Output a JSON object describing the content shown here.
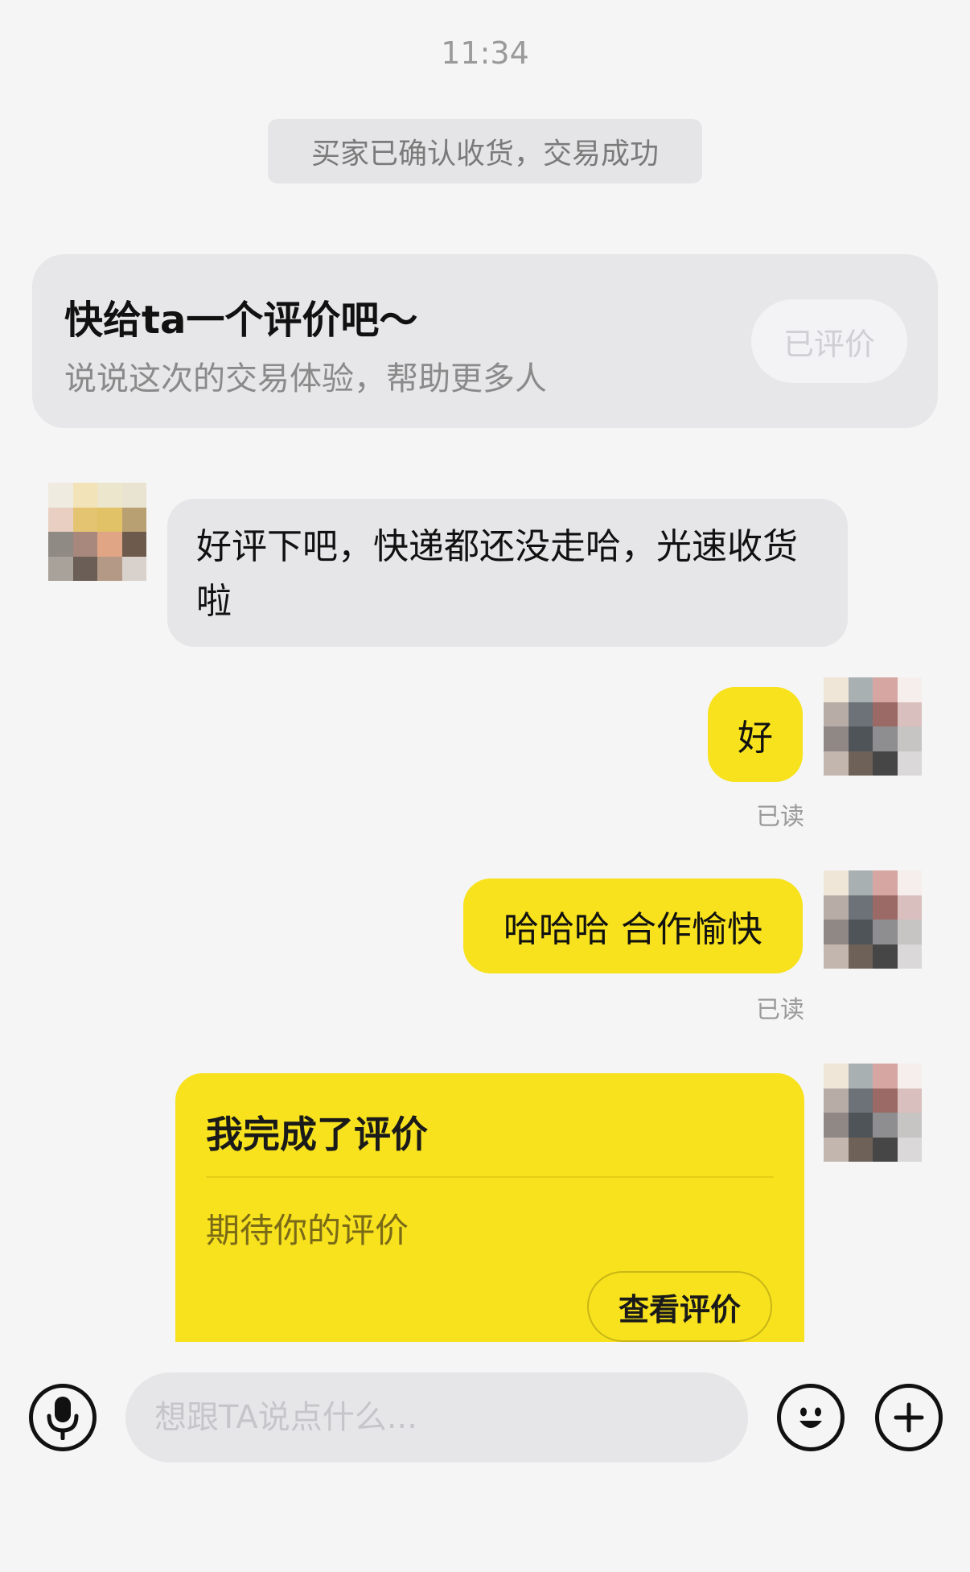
{
  "header": {
    "time": "11:34"
  },
  "system_note": "买家已确认收货，交易成功",
  "review_prompt": {
    "title": "快给ta一个评价吧～",
    "subtitle": "说说这次的交易体验，帮助更多人",
    "button_label": "已评价"
  },
  "messages": [
    {
      "from": "other",
      "text": "好评下吧，快递都还没走哈，光速收货啦"
    },
    {
      "from": "me",
      "text": "好",
      "status": "已读"
    },
    {
      "from": "me",
      "text": "哈哈哈 合作愉快",
      "status": "已读"
    }
  ],
  "evaluation_card": {
    "title": "我完成了评价",
    "subtitle": "期待你的评价",
    "button_label": "查看评价"
  },
  "input_bar": {
    "placeholder": "想跟TA说点什么...",
    "voice_icon": "microphone-icon",
    "emoji_icon": "smiley-icon",
    "more_icon": "plus-circle-icon"
  },
  "colors": {
    "accent_yellow": "#f7e21d",
    "bubble_gray": "#e6e6e8",
    "background": "#f5f5f5"
  }
}
